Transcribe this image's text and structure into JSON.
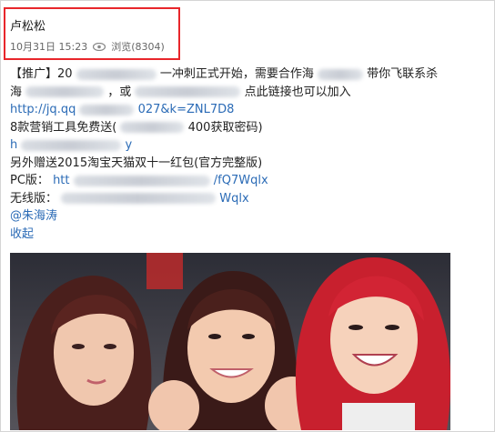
{
  "post": {
    "author": "卢松松",
    "date": "10月31日 15:23",
    "views": "浏览(8304)",
    "lines": [
      {
        "a": "【推广】20",
        "b": "一冲刺正式开始，需要合作海",
        "c": "带你飞联系杀"
      },
      {
        "a": "海",
        "b": "，或",
        "c": "点此链接也可以加入"
      },
      {
        "a": "http://jq.qq",
        "b": "027&k=ZNL7D8"
      },
      {
        "a": "8款营销工具免费送(",
        "b": "400获取密码)"
      },
      {
        "a": "h",
        "b": "y"
      },
      {
        "a": "另外赠送2015淘宝天猫双十一红包(官方完整版)"
      },
      {
        "a": "PC版：",
        "b": "htt",
        "c": "/fQ7Wqlx"
      },
      {
        "a": "无线版：",
        "b": "Wqlx"
      }
    ],
    "mention": "@朱海涛",
    "collapse": "收起"
  },
  "colors": {
    "highlight": "#e8262b",
    "link": "#2b6bb6"
  }
}
